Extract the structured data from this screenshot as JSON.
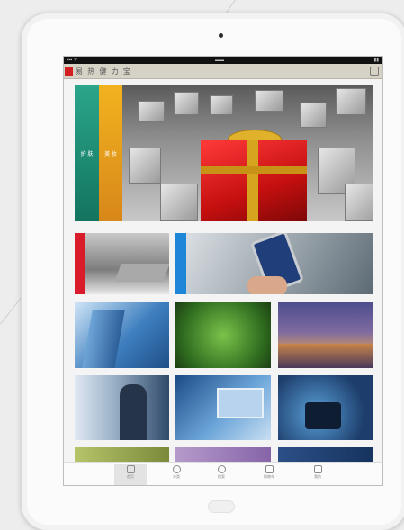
{
  "screen": {
    "app_title": "易 热 健 力 宝",
    "status_left": "▪▪▪ ᯤ",
    "status_center": "▬▬",
    "status_right": "▮▮",
    "hero_tags": [
      "护 肤",
      "美 妆"
    ],
    "tabbar": {
      "items": [
        {
          "label": "首页"
        },
        {
          "label": "分类"
        },
        {
          "label": "搜索"
        },
        {
          "label": "购物车"
        },
        {
          "label": "我的"
        }
      ]
    }
  },
  "colors": {
    "green_tag": "#1f8f75",
    "orange_tag": "#e79a1c",
    "red_tag": "#d91c2a",
    "blue_tag": "#1e86d6",
    "gift": "#d01414"
  }
}
